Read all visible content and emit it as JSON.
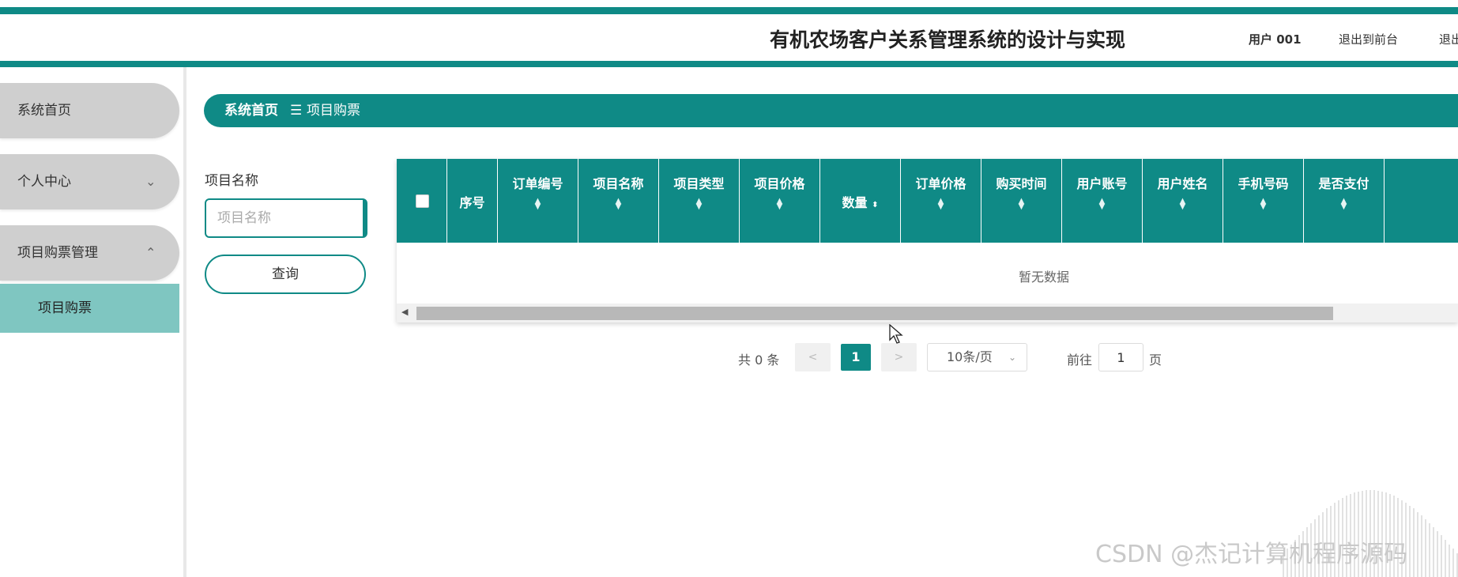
{
  "app": {
    "title": "有机农场客户关系管理系统的设计与实现",
    "user_label": "用户 001",
    "exit_front_label": "退出到前台",
    "exit_label": "退出"
  },
  "colors": {
    "primary": "#0f8a86",
    "sidebar_item": "#cfcfcf",
    "sidebar_active": "#7fc6c1"
  },
  "sidebar": {
    "items": [
      {
        "label": "系统首页"
      },
      {
        "label": "个人中心",
        "icon": "chevron-down-icon"
      },
      {
        "label": "项目购票管理",
        "icon": "chevron-up-icon"
      }
    ],
    "sub_item": {
      "label": "项目购票"
    }
  },
  "breadcrumb": {
    "home": "系统首页",
    "separator": "☰",
    "current": "项目购票"
  },
  "filter": {
    "label": "项目名称",
    "placeholder": "项目名称",
    "value": "",
    "query_label": "查询"
  },
  "table": {
    "columns": [
      "序号",
      "订单编号",
      "项目名称",
      "项目类型",
      "项目价格",
      "数量",
      "订单价格",
      "购买时间",
      "用户账号",
      "用户姓名",
      "手机号码",
      "是否支付"
    ],
    "rows": [],
    "empty_text": "暂无数据"
  },
  "pagination": {
    "total_label": "共 0 条",
    "prev": "<",
    "next": ">",
    "current_page": "1",
    "page_size": "10条/页",
    "goto_label": "前往",
    "goto_value": "1",
    "goto_unit": "页"
  },
  "watermark": "CSDN @杰记计算机程序源码"
}
